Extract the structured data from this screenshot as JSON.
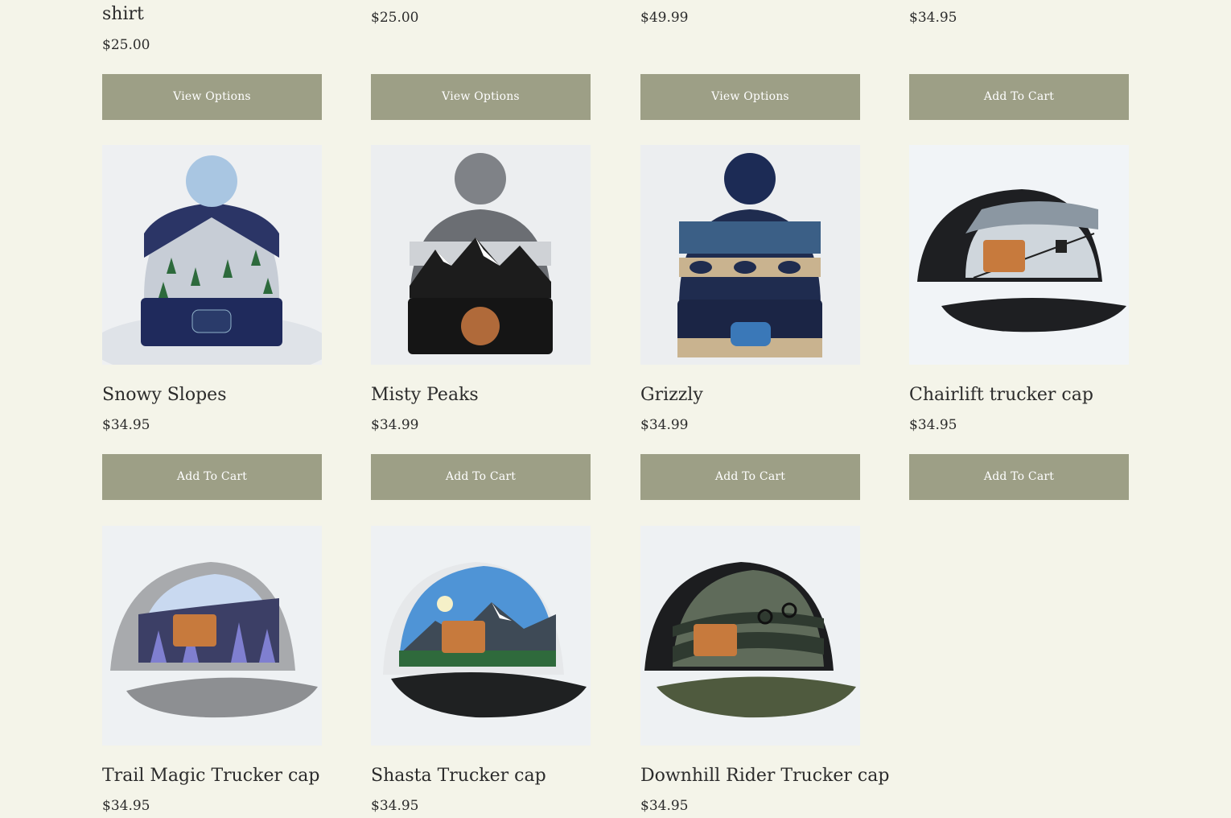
{
  "top_row": [
    {
      "title_tail": "shirt",
      "price": "$25.00",
      "button": "View Options"
    },
    {
      "price": "$25.00",
      "button": "View Options"
    },
    {
      "price": "$49.99",
      "button": "View Options"
    },
    {
      "price": "$34.95",
      "button": "Add To Cart"
    }
  ],
  "products": [
    {
      "name": "Snowy Slopes",
      "price": "$34.95",
      "button": "Add To Cart",
      "image": "navy-beanie-snow-trees"
    },
    {
      "name": "Misty Peaks",
      "price": "$34.99",
      "button": "Add To Cart",
      "image": "grey-black-beanie-mountains"
    },
    {
      "name": "Grizzly",
      "price": "$34.99",
      "button": "Add To Cart",
      "image": "navy-tan-beanie-bears"
    },
    {
      "name": "Chairlift trucker cap",
      "price": "$34.95",
      "button": "Add To Cart",
      "image": "black-trucker-cap-chairlift"
    },
    {
      "name": "Trail Magic Trucker cap",
      "price": "$34.95",
      "image": "grey-trucker-cap-trees"
    },
    {
      "name": "Shasta Trucker cap",
      "price": "$34.95",
      "image": "white-trucker-cap-mountain"
    },
    {
      "name": "Downhill Rider Trucker cap",
      "price": "$34.95",
      "image": "olive-trucker-cap-bike"
    }
  ],
  "colors": {
    "background": "#f4f4e9",
    "button": "#9d9f86",
    "button_text": "#ffffff"
  }
}
